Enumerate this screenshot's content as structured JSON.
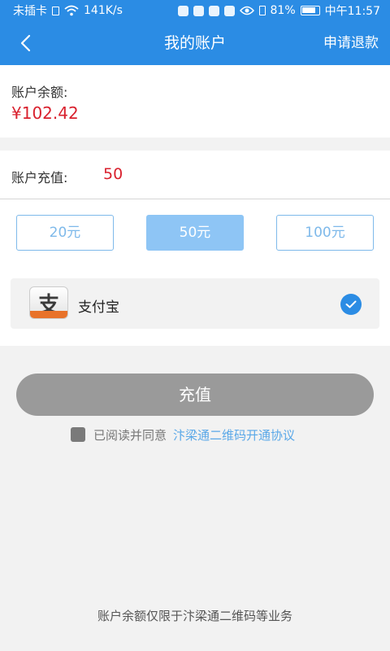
{
  "status_bar": {
    "carrier": "未插卡",
    "speed": "141K/s",
    "battery": "81%",
    "time": "中午11:57"
  },
  "nav": {
    "title": "我的账户",
    "action": "申请退款"
  },
  "balance": {
    "label": "账户余额:",
    "value": "¥102.42"
  },
  "recharge": {
    "label": "账户充值:",
    "value": "50",
    "options": [
      "20元",
      "50元",
      "100元"
    ],
    "selected_index": 1
  },
  "payment": {
    "icon_glyph": "支",
    "method": "支付宝",
    "checked": true
  },
  "submit_label": "充值",
  "agreement": {
    "text": "已阅读并同意",
    "link": "汴梁通二维码开通协议"
  },
  "footer_note": "账户余额仅限于汴梁通二维码等业务",
  "colors": {
    "accent": "#2b8ce4",
    "price": "#d9212e",
    "selected_option": "#8ec5f5",
    "disabled_button": "#9a9a9a",
    "link": "#5aa8e8"
  }
}
